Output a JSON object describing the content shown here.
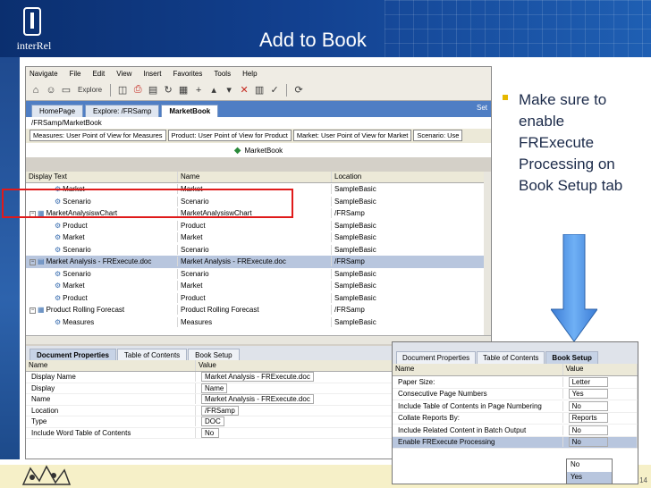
{
  "slide": {
    "title": "Add to Book",
    "logo_text": "interRel",
    "page_number": "14",
    "bullet": "Make sure to enable FRExecute Processing on Book Setup tab",
    "colors": {
      "header": "#12408f",
      "bullet": "#e6b800",
      "arrow": "#4a90e2",
      "highlight": "#e01a1a"
    }
  },
  "app": {
    "menu": [
      "Navigate",
      "File",
      "Edit",
      "View",
      "Insert",
      "Favorites",
      "Tools",
      "Help"
    ],
    "toolbar": {
      "explore_label": "Explore"
    },
    "tabs": [
      "HomePage",
      "Explore: /FRSamp",
      "MarketBook"
    ],
    "active_tab": 2,
    "tab_controls": "Set",
    "path": "/FRSamp/MarketBook",
    "pov": [
      "Measures: User Point of View for Measures",
      "Product: User Point of View for Product",
      "Market: User Point of View for Market",
      "Scenario: Use"
    ],
    "book_title": "MarketBook",
    "grid": {
      "columns": [
        "Display Text",
        "Name",
        "Location"
      ],
      "rows": [
        {
          "indent": 1,
          "expander": "",
          "icon": "member-icon",
          "display": "Market",
          "name": "Market",
          "location": "SampleBasic"
        },
        {
          "indent": 1,
          "expander": "",
          "icon": "member-icon",
          "display": "Scenario",
          "name": "Scenario",
          "location": "SampleBasic"
        },
        {
          "indent": 0,
          "expander": "−",
          "icon": "report-icon",
          "display": "MarketAnalysiswChart",
          "name": "MarketAnalysiswChart",
          "location": "/FRSamp"
        },
        {
          "indent": 1,
          "expander": "",
          "icon": "member-icon",
          "display": "Product",
          "name": "Product",
          "location": "SampleBasic"
        },
        {
          "indent": 1,
          "expander": "",
          "icon": "member-icon",
          "display": "Market",
          "name": "Market",
          "location": "SampleBasic"
        },
        {
          "indent": 1,
          "expander": "",
          "icon": "member-icon",
          "display": "Scenario",
          "name": "Scenario",
          "location": "SampleBasic"
        },
        {
          "indent": 0,
          "expander": "−",
          "icon": "doc-icon",
          "display": "Market Analysis - FRExecute.doc",
          "name": "Market Analysis - FRExecute.doc",
          "location": "/FRSamp",
          "selected": true
        },
        {
          "indent": 1,
          "expander": "",
          "icon": "member-icon",
          "display": "Scenario",
          "name": "Scenario",
          "location": "SampleBasic"
        },
        {
          "indent": 1,
          "expander": "",
          "icon": "member-icon",
          "display": "Market",
          "name": "Market",
          "location": "SampleBasic"
        },
        {
          "indent": 1,
          "expander": "",
          "icon": "member-icon",
          "display": "Product",
          "name": "Product",
          "location": "SampleBasic"
        },
        {
          "indent": 0,
          "expander": "−",
          "icon": "report-icon",
          "display": "Product Rolling Forecast",
          "name": "Product Rolling Forecast",
          "location": "/FRSamp"
        },
        {
          "indent": 1,
          "expander": "",
          "icon": "member-icon",
          "display": "Measures",
          "name": "Measures",
          "location": "SampleBasic"
        }
      ]
    },
    "props": {
      "tabs": [
        "Document Properties",
        "Table of Contents",
        "Book Setup"
      ],
      "active_tab": 0,
      "columns": [
        "Name",
        "Value"
      ],
      "rows": [
        {
          "name": "Display Name",
          "value": "Market Analysis - FRExecute.doc"
        },
        {
          "name": "Display",
          "value": "Name"
        },
        {
          "name": "Name",
          "value": "Market Analysis - FRExecute.doc"
        },
        {
          "name": "Location",
          "value": "/FRSamp"
        },
        {
          "name": "Type",
          "value": "DOC"
        },
        {
          "name": "Include Word Table of Contents",
          "value": "No"
        }
      ]
    }
  },
  "setup": {
    "tabs": [
      "Document Properties",
      "Table of Contents",
      "Book Setup"
    ],
    "active_tab": 2,
    "columns": [
      "Name",
      "Value"
    ],
    "rows": [
      {
        "name": "Paper Size:",
        "value": "Letter"
      },
      {
        "name": "Consecutive Page Numbers",
        "value": "Yes"
      },
      {
        "name": "Include Table of Contents in Page Numbering",
        "value": "No"
      },
      {
        "name": "Collate Reports By:",
        "value": "Reports"
      },
      {
        "name": "Include Related Content in Batch Output",
        "value": "No"
      },
      {
        "name": "Enable FRExecute Processing",
        "value": "No",
        "selected": true
      }
    ],
    "dropdown": [
      "No",
      "Yes"
    ],
    "dropdown_selected": 1
  }
}
